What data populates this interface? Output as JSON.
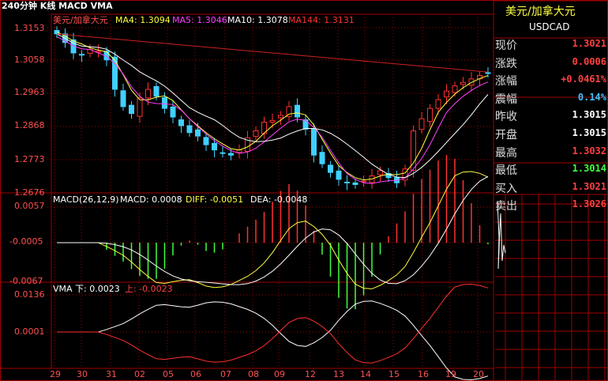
{
  "chart": {
    "title": "240分钟 K线 MACD VMA",
    "price_panel": {
      "pair_label": "美元/加拿大元",
      "ma4": "MA4: 1.3094",
      "ma5": "MA5: 1.3046",
      "ma10": "MA10: 1.3078",
      "ma144": "MA144: 1.3131",
      "y_ticks": [
        "1.3153",
        "1.3058",
        "1.2963",
        "1.2868",
        "1.2773",
        "1.2676"
      ]
    },
    "macd_panel": {
      "label": "MACD(26,12,9)",
      "macd": "MACD: 0.0008",
      "diff": "DIFF: -0.0051",
      "dea": "DEA: -0.0048",
      "y_ticks": [
        "0.0057",
        "-0.0005",
        "-0.0067"
      ]
    },
    "vma_panel": {
      "label": "VMA",
      "down": "下: 0.0023",
      "up": "上: -0.0023",
      "y_ticks": [
        "0.0136",
        "0.0001"
      ]
    },
    "x_ticks": [
      "29",
      "30",
      "31",
      "02",
      "05",
      "06",
      "07",
      "08",
      "09",
      "12",
      "13",
      "14",
      "15",
      "16",
      "19",
      "20"
    ]
  },
  "chart_data": {
    "type": "candlestick",
    "title": "240分钟 K线 MACD VMA",
    "y_range": [
      1.2676,
      1.3153
    ],
    "close_series": [
      1.3135,
      1.311,
      1.308,
      1.3075,
      1.309,
      1.3085,
      1.306,
      1.2975,
      1.2925,
      1.2905,
      1.295,
      1.2975,
      1.2955,
      1.292,
      1.2895,
      1.287,
      1.285,
      1.284,
      1.2815,
      1.28,
      1.279,
      1.2785,
      1.28,
      1.2835,
      1.2855,
      1.288,
      1.2885,
      1.29,
      1.2925,
      1.2895,
      1.286,
      1.2785,
      1.276,
      1.2735,
      1.2715,
      1.2705,
      1.27,
      1.271,
      1.2725,
      1.274,
      1.272,
      1.2705,
      1.2745,
      1.2855,
      1.289,
      1.292,
      1.2945,
      1.297,
      1.2985,
      1.2995,
      1.3005,
      1.3015,
      1.3021
    ]
  },
  "quote": {
    "name": "美元/加拿大元",
    "code": "USDCAD",
    "rows": [
      {
        "label": "现价",
        "value": "1.3021",
        "color": "#ff4040"
      },
      {
        "label": "涨跌",
        "value": "0.0006",
        "color": "#ff4040"
      },
      {
        "label": "涨幅",
        "value": "+0.0461%",
        "color": "#ff4040"
      },
      {
        "label": "震幅",
        "value": "0.14%",
        "color": "#40c0ff"
      },
      {
        "label": "昨收",
        "value": "1.3015",
        "color": "#ffffff"
      },
      {
        "label": "开盘",
        "value": "1.3015",
        "color": "#ffffff"
      },
      {
        "label": "最高",
        "value": "1.3032",
        "color": "#ff4040"
      },
      {
        "label": "最低",
        "value": "1.3014",
        "color": "#40ff40"
      },
      {
        "label": "买入",
        "value": "1.3021",
        "color": "#ff4040"
      },
      {
        "label": "卖出",
        "value": "1.3026",
        "color": "#ff4040"
      }
    ]
  }
}
